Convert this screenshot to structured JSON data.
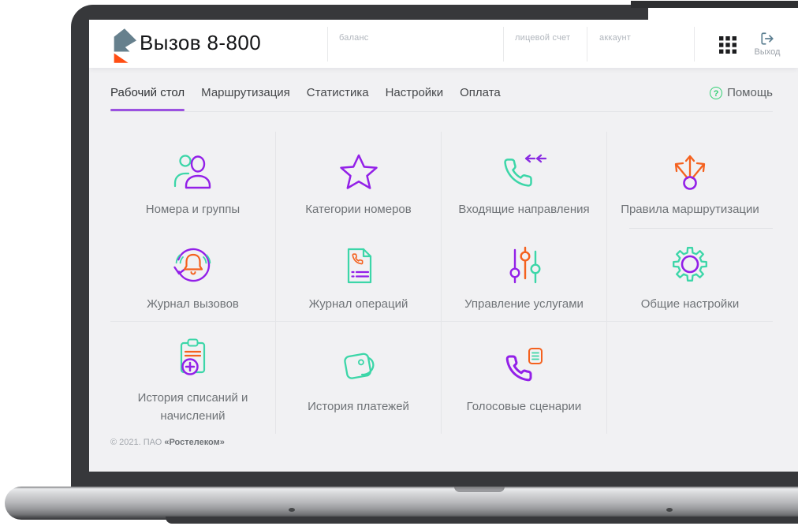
{
  "brand": {
    "title": "Вызов 8-800",
    "logo_icon": "rostelecom-logo"
  },
  "topbar": {
    "fields": [
      {
        "label": "баланс"
      },
      {
        "label": "лицевой счет"
      },
      {
        "label": "аккаунт"
      }
    ],
    "apps_icon": "apps-grid-icon",
    "logout": {
      "label": "Выход",
      "icon": "logout-icon"
    }
  },
  "nav": {
    "tabs": [
      {
        "label": "Рабочий стол",
        "active": true
      },
      {
        "label": "Маршрутизация",
        "active": false
      },
      {
        "label": "Статистика",
        "active": false
      },
      {
        "label": "Настройки",
        "active": false
      },
      {
        "label": "Оплата",
        "active": false
      }
    ],
    "help": {
      "label": "Помощь",
      "icon": "question-circle-icon"
    }
  },
  "tiles": [
    {
      "label": "Номера и группы",
      "icon": "users-icon"
    },
    {
      "label": "Категории номеров",
      "icon": "star-icon"
    },
    {
      "label": "Входящие направления",
      "icon": "incoming-call-icon"
    },
    {
      "label": "Правила маршрутизации",
      "icon": "routing-icon"
    },
    {
      "label": "Журнал вызовов",
      "icon": "call-log-bell-icon"
    },
    {
      "label": "Журнал операций",
      "icon": "operations-document-icon"
    },
    {
      "label": "Управление услугами",
      "icon": "sliders-icon"
    },
    {
      "label": "Общие настройки",
      "icon": "gear-icon"
    },
    {
      "label": "История списаний и начислений",
      "icon": "clipboard-plus-icon"
    },
    {
      "label": "История платежей",
      "icon": "wallet-icon"
    },
    {
      "label": "Голосовые сценарии",
      "icon": "voice-script-icon"
    }
  ],
  "footer": {
    "copyright": "© 2021. ПАО ",
    "company": "«Ростелеком»"
  },
  "colors": {
    "accent_purple": "#9320e8",
    "underline_purple": "#9b51e0",
    "teal": "#3cd6a8",
    "orange": "#f4611e",
    "help_green": "#31d073",
    "logout_gray": "#5c7f91",
    "bezel": "#37383b"
  }
}
